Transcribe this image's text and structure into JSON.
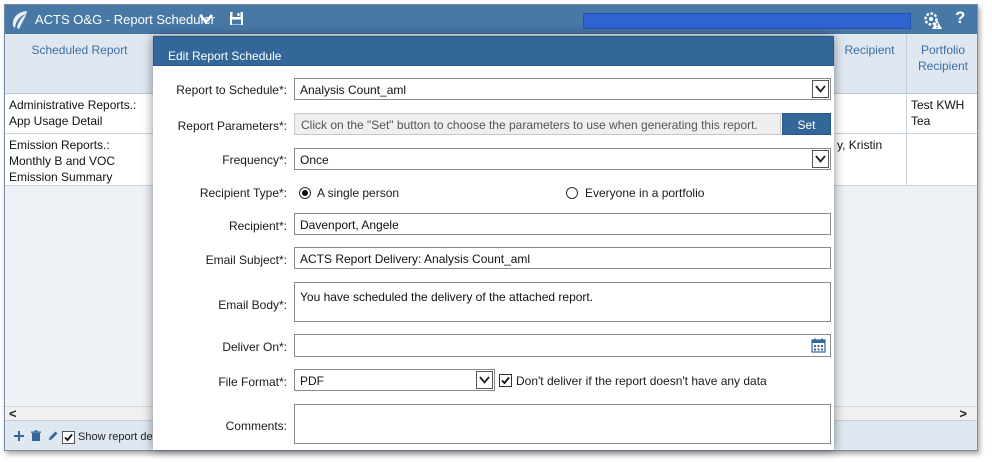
{
  "app": {
    "title": "ACTS O&G - Report Scheduler",
    "help_label": "?"
  },
  "grid": {
    "headers": [
      {
        "label": "Scheduled Report"
      },
      {
        "label": "Recipient"
      },
      {
        "label": "Portfolio Recipient"
      }
    ],
    "rows": [
      {
        "report": "Administrative Reports.: App Usage Detail",
        "recipient": "",
        "portfolio": "Test KWH Tea"
      },
      {
        "report": "Emission Reports.: Monthly B and VOC Emission Summary",
        "recipient": "y, Kristin",
        "portfolio": ""
      }
    ],
    "scroll_left": "<",
    "scroll_right": ">",
    "show_label": "Show report deliv"
  },
  "modal": {
    "title": "Edit Report Schedule",
    "report_to_schedule": {
      "label": "Report to Schedule*:",
      "value": "Analysis Count_aml"
    },
    "report_parameters": {
      "label": "Report Parameters*:",
      "value": "Click on the \"Set\" button to choose the parameters to use when generating this report.",
      "button": "Set"
    },
    "frequency": {
      "label": "Frequency*:",
      "value": "Once"
    },
    "recipient_type": {
      "label": "Recipient Type*:",
      "options": [
        {
          "label": "A single person",
          "selected": true
        },
        {
          "label": "Everyone in a portfolio",
          "selected": false
        }
      ]
    },
    "recipient": {
      "label": "Recipient*:",
      "value": "Davenport, Angele"
    },
    "email_subject": {
      "label": "Email Subject*:",
      "value": "ACTS Report Delivery: Analysis Count_aml"
    },
    "email_body": {
      "label": "Email Body*:",
      "value": "You have scheduled the delivery of the attached report."
    },
    "deliver_on": {
      "label": "Deliver On*:",
      "value": ""
    },
    "file_format": {
      "label": "File Format*:",
      "value": "PDF",
      "no_data_label": "Don't deliver if the report doesn't have any data",
      "no_data_checked": true
    },
    "comments": {
      "label": "Comments:",
      "value": ""
    }
  }
}
